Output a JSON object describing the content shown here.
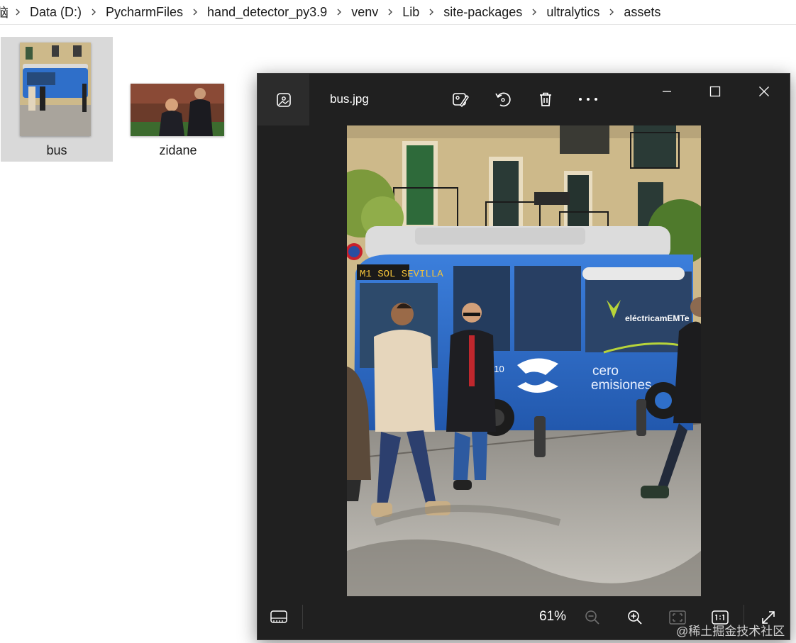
{
  "breadcrumb": {
    "partial_first": "脑",
    "items": [
      "Data (D:)",
      "PycharmFiles",
      "hand_detector_py3.9",
      "venv",
      "Lib",
      "site-packages",
      "ultralytics",
      "assets"
    ]
  },
  "files": [
    {
      "name": "bus",
      "selected": true
    },
    {
      "name": "zidane",
      "selected": false
    }
  ],
  "viewer": {
    "file_title": "bus.jpg",
    "zoom_level": "61%",
    "toolbar_icons": [
      "edit-image-icon",
      "rotate-icon",
      "delete-icon",
      "more-icon"
    ],
    "window_controls": [
      "minimize-icon",
      "maximize-icon",
      "close-icon"
    ],
    "bottom_icons": [
      "filmstrip-icon",
      "zoom-out-icon",
      "zoom-in-icon",
      "fit-to-window-icon",
      "actual-size-icon",
      "full-screen-icon"
    ],
    "image_text": {
      "bus_destination": "M1 SOL SEVILLA",
      "bus_logo": "eléctricamEMTe",
      "bus_slogan_1": "cero",
      "bus_slogan_2": "emisiones",
      "bus_number": "010"
    }
  },
  "watermark": "@稀土掘金技术社区",
  "colors": {
    "viewer_bg": "#202020",
    "bus_blue": "#2f6fc9",
    "selection_bg": "#d9d9d9"
  }
}
